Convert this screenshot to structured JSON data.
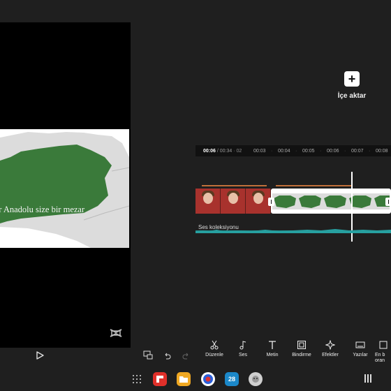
{
  "preview": {
    "subtitle": "ur Anadolu size bir mezar",
    "brand_icon": "capcut-logo-icon",
    "play_icon": "play-icon"
  },
  "import": {
    "label": "İçe aktar",
    "icon": "plus-icon"
  },
  "timeline": {
    "current_time": "00:06",
    "total_time": "/ 00:34",
    "ticks": [
      "00:03",
      "00:04",
      "00:05",
      "00:06",
      "00:07",
      "00:08"
    ],
    "audio_label": "Ses koleksiyonu"
  },
  "toolbar": {
    "items": [
      {
        "label": "Düzenle",
        "icon": "scissors-icon"
      },
      {
        "label": "Ses",
        "icon": "music-note-icon"
      },
      {
        "label": "Metin",
        "icon": "text-icon"
      },
      {
        "label": "Bindirme",
        "icon": "overlay-icon"
      },
      {
        "label": "Efektler",
        "icon": "sparkle-icon"
      },
      {
        "label": "Yazılar",
        "icon": "captions-icon"
      },
      {
        "label": "En b oran",
        "icon": "aspect-ratio-icon"
      }
    ]
  },
  "mini_controls": [
    "resolution-icon",
    "undo-icon",
    "redo-icon"
  ],
  "taskbar": {
    "apps": [
      "app-drawer-icon",
      "flipboard-icon",
      "files-icon",
      "browser-icon",
      "calendar-icon",
      "chat-icon",
      "recents-icon"
    ],
    "calendar_day": "28"
  },
  "colors": {
    "accent_green": "#3a7a3a",
    "waveform": "#1e8c8c",
    "track_line": "#c0703a"
  }
}
